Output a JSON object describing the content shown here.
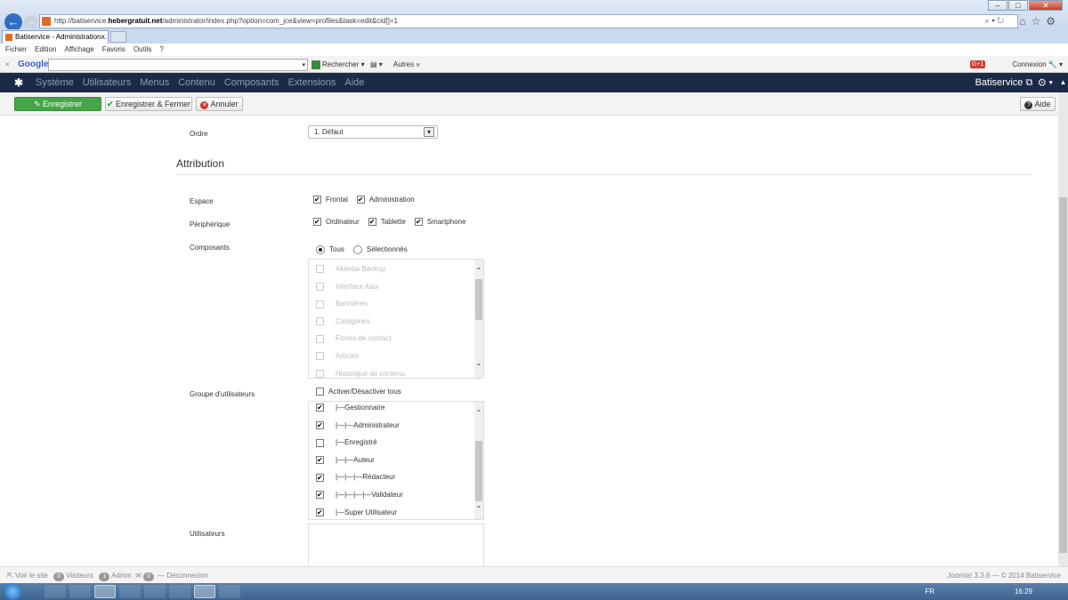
{
  "browser": {
    "address_prefix": "http://batiservice.",
    "address_domain": "hebergratuit.net",
    "address_path": "/administrator/index.php?option=com_jce&view=profiles&task=edit&cid[]=1",
    "tab_title": "Batiservice - Administration...",
    "menu": [
      "Fichier",
      "Edition",
      "Affichage",
      "Favoris",
      "Outils",
      "?"
    ],
    "google_logo": "Google",
    "rechercher": "Rechercher",
    "autres": "Autres",
    "connexion": "Connexion"
  },
  "joomla_nav": {
    "items": [
      "Système",
      "Utilisateurs",
      "Menus",
      "Contenu",
      "Composants",
      "Extensions",
      "Aide"
    ],
    "site_name": "Batiservice"
  },
  "toolbar": {
    "save": "Enregistrer",
    "save_close": "Enregistrer & Fermer",
    "cancel": "Annuler",
    "help": "Aide"
  },
  "form": {
    "ordre_label": "Ordre",
    "ordre_value": "1. Défaut",
    "attribution_title": "Attribution",
    "espace_label": "Espace",
    "espace_options": [
      {
        "label": "Frontal",
        "checked": true
      },
      {
        "label": "Administration",
        "checked": true
      }
    ],
    "peripherique_label": "Périphérique",
    "peripherique_options": [
      {
        "label": "Ordinateur",
        "checked": true
      },
      {
        "label": "Tablette",
        "checked": true
      },
      {
        "label": "Smartphone",
        "checked": true
      }
    ],
    "composants_label": "Composants",
    "composants_radios": [
      {
        "label": "Tous",
        "selected": true
      },
      {
        "label": "Sélectionnés",
        "selected": false
      }
    ],
    "composants_list": [
      "Akeeba Backup",
      "Interface Ajax",
      "Bannières",
      "Catégories",
      "Fiches de contact",
      "Articles",
      "Historique de contenu"
    ],
    "groupes_label": "Groupe d'utilisateurs",
    "toggle_all": "Activer/Désactiver tous",
    "groupes_list": [
      {
        "label": "|—Gestionnaire",
        "checked": true
      },
      {
        "label": "|—|—Administrateur",
        "checked": true
      },
      {
        "label": "|—Enregistré",
        "checked": false
      },
      {
        "label": "|—|—Auteur",
        "checked": true
      },
      {
        "label": "|—|—|—Rédacteur",
        "checked": true
      },
      {
        "label": "|—|—|—|—Validateur",
        "checked": true
      },
      {
        "label": "|—Super Utilisateur",
        "checked": true
      }
    ],
    "utilisateurs_label": "Utilisateurs"
  },
  "status": {
    "voir_site": "Voir le site",
    "visiteurs_count": "0",
    "visiteurs": "Visiteurs",
    "admin_count": "1",
    "admin": "Admin",
    "messages_count": "0",
    "deconnexion": "Déconnexion",
    "footer": "Joomla! 3.3.6 — © 2014 Batiservice"
  },
  "taskbar": {
    "lang": "FR",
    "time": "16:29"
  }
}
